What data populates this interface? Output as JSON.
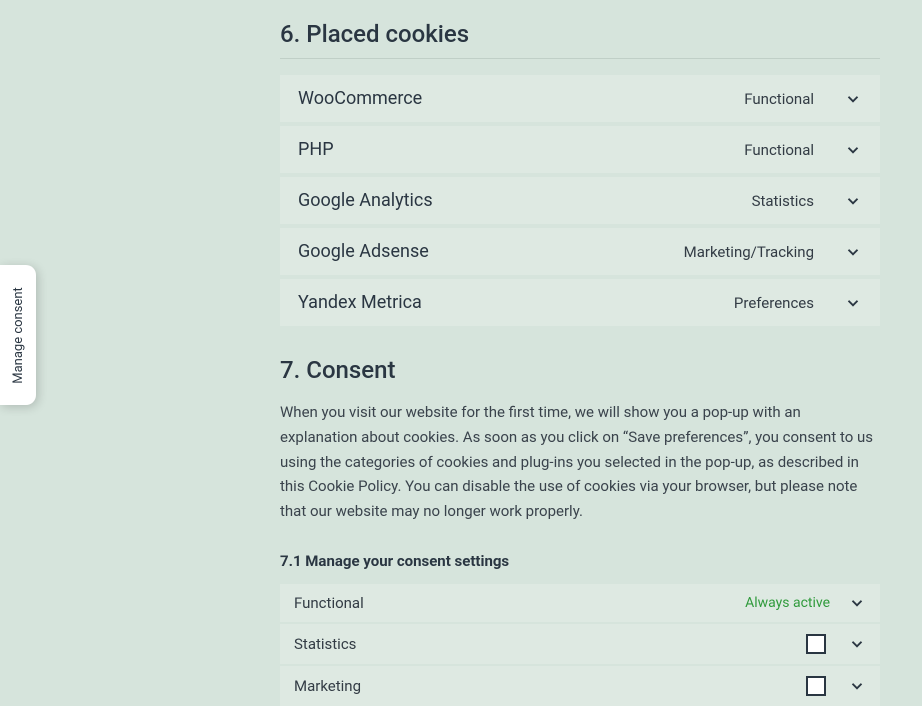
{
  "headings": {
    "placed_cookies": "6. Placed cookies",
    "consent": "7. Consent",
    "manage_settings": "7.1 Manage your consent settings"
  },
  "cookies": [
    {
      "name": "WooCommerce",
      "tag": "Functional"
    },
    {
      "name": "PHP",
      "tag": "Functional"
    },
    {
      "name": "Google Analytics",
      "tag": "Statistics"
    },
    {
      "name": "Google Adsense",
      "tag": "Marketing/Tracking"
    },
    {
      "name": "Yandex Metrica",
      "tag": "Preferences"
    }
  ],
  "consent_paragraph": "When you visit our website for the first time, we will show you a pop-up with an explanation about cookies. As soon as you click on “Save preferences”, you consent to us using the categories of cookies and plug-ins you selected in the pop-up, as described in this Cookie Policy. You can disable the use of cookies via your browser, but please note that our website may no longer work properly.",
  "consent_rows": {
    "functional": {
      "label": "Functional",
      "status": "Always active"
    },
    "statistics": {
      "label": "Statistics"
    },
    "marketing": {
      "label": "Marketing"
    }
  },
  "side_tab": "Manage consent"
}
